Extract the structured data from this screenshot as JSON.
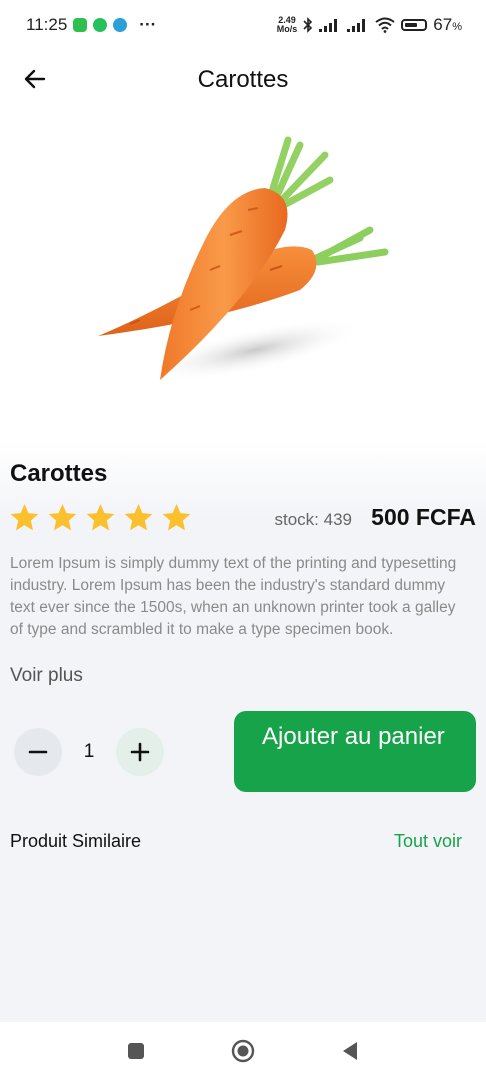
{
  "status_bar": {
    "time": "11:25",
    "dots": "···",
    "net_speed_value": "2.49",
    "net_speed_unit": "Mo/s",
    "battery_percent": "67",
    "battery_suffix": "%",
    "battery_level": 0.67,
    "app_icons": [
      "messages-icon",
      "whatsapp-icon",
      "telegram-icon"
    ]
  },
  "header": {
    "title": "Carottes",
    "back_icon": "arrow-left-icon"
  },
  "product": {
    "image": "carrot-photo",
    "name": "Carottes",
    "rating": 5,
    "rating_max": 5,
    "stock_label": "stock: 439",
    "price": "500 FCFA",
    "description": "Lorem Ipsum is simply dummy text of the printing and typesetting industry. Lorem Ipsum has been the industry's standard dummy text ever since the 1500s, when an unknown printer took a galley of type and scrambled it to make a type specimen book.",
    "see_more": "Voir plus"
  },
  "cart": {
    "quantity": "1",
    "decrement_icon": "minus-icon",
    "increment_icon": "plus-icon",
    "add_label": "Ajouter au panier"
  },
  "similar": {
    "title": "Produit Similaire",
    "see_all": "Tout voir"
  },
  "colors": {
    "accent": "#17a349",
    "star": "#fbc02d",
    "background": "#f3f4f8"
  },
  "nav": {
    "items": [
      "recent-apps-icon",
      "home-icon",
      "back-triangle-icon"
    ]
  }
}
